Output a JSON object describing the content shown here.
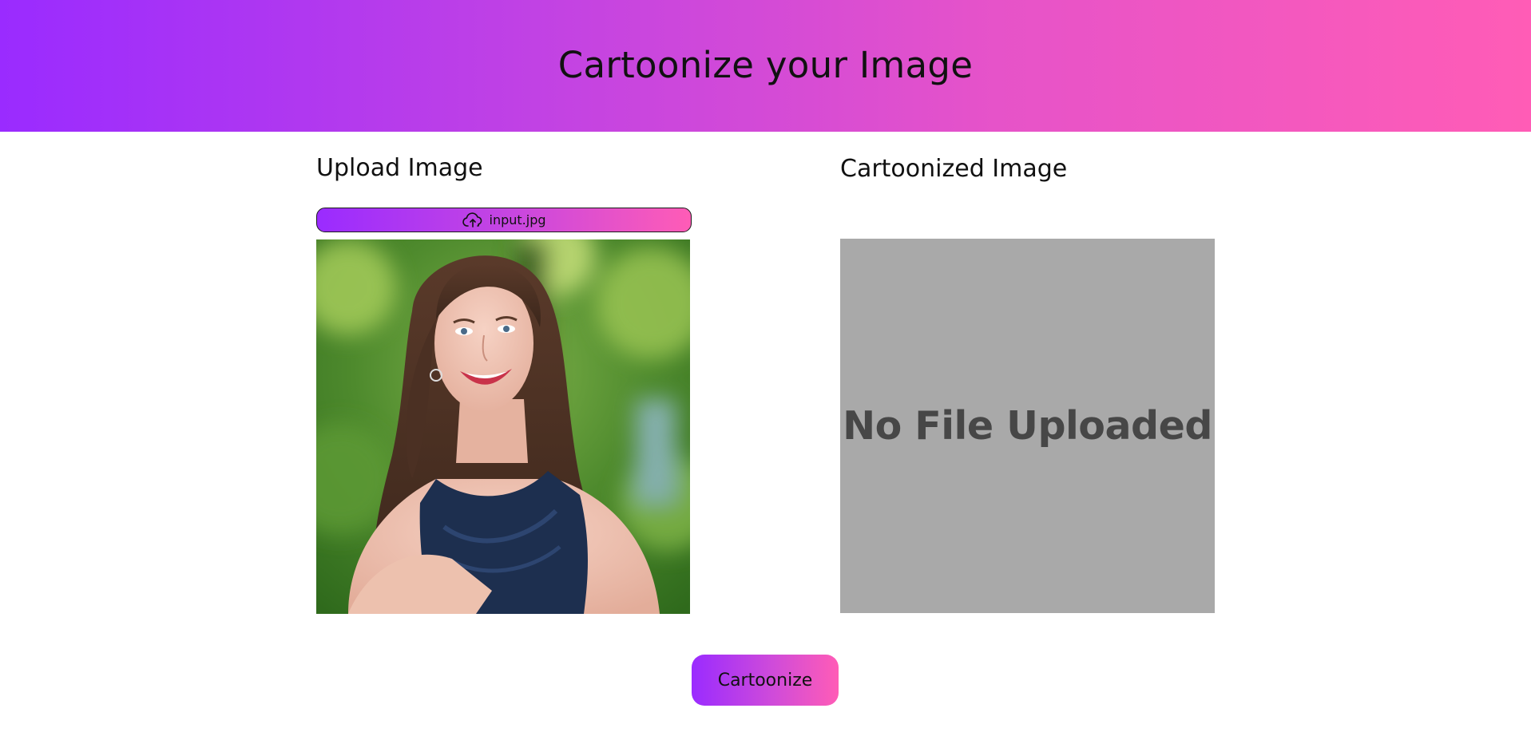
{
  "header": {
    "title": "Cartoonize your Image",
    "gradient_start": "#9a2bff",
    "gradient_end": "#ff5cb6"
  },
  "upload": {
    "title": "Upload Image",
    "file_name": "input.jpg",
    "upload_icon": "cloud-upload-icon",
    "image_alt": "Uploaded photo of a smiling woman"
  },
  "output": {
    "title": "Cartoonized Image",
    "placeholder": "No File Uploaded",
    "placeholder_bg": "#a9a9a9"
  },
  "actions": {
    "cartoonize_label": "Cartoonize"
  }
}
